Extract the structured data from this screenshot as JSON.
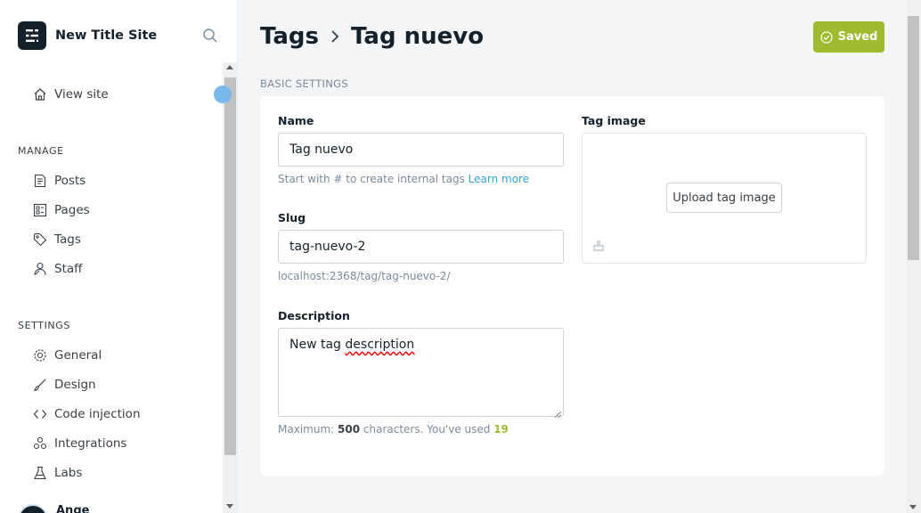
{
  "site": {
    "name": "New Title Site"
  },
  "sidebar": {
    "view_site": "View site",
    "manage_label": "MANAGE",
    "manage_items": [
      {
        "label": "Posts",
        "icon": "posts-icon"
      },
      {
        "label": "Pages",
        "icon": "pages-icon"
      },
      {
        "label": "Tags",
        "icon": "tag-icon"
      },
      {
        "label": "Staff",
        "icon": "staff-icon"
      }
    ],
    "settings_label": "SETTINGS",
    "settings_items": [
      {
        "label": "General",
        "icon": "gear-icon"
      },
      {
        "label": "Design",
        "icon": "brush-icon"
      },
      {
        "label": "Code injection",
        "icon": "code-icon"
      },
      {
        "label": "Integrations",
        "icon": "integrations-icon"
      },
      {
        "label": "Labs",
        "icon": "flask-icon"
      }
    ],
    "user_partial": "Ange"
  },
  "header": {
    "breadcrumb_parent": "Tags",
    "title": "Tag nuevo",
    "status_button": "Saved"
  },
  "form": {
    "section_label": "BASIC SETTINGS",
    "name_label": "Name",
    "name_value": "Tag nuevo",
    "name_hint": "Start with # to create internal tags",
    "name_hint_link": "Learn more",
    "slug_label": "Slug",
    "slug_value": "tag-nuevo-2",
    "slug_url": "localhost:2368/tag/tag-nuevo-2/",
    "description_label": "Description",
    "description_value_a": "New tag ",
    "description_value_b": "description",
    "desc_hint_prefix": "Maximum:",
    "desc_max": "500",
    "desc_hint_mid": "characters. You've used",
    "desc_used": "19",
    "image_label": "Tag image",
    "upload_button": "Upload tag image"
  },
  "colors": {
    "accent_green": "#9fbb30",
    "link_blue": "#30a3d9",
    "dark": "#15212a"
  }
}
